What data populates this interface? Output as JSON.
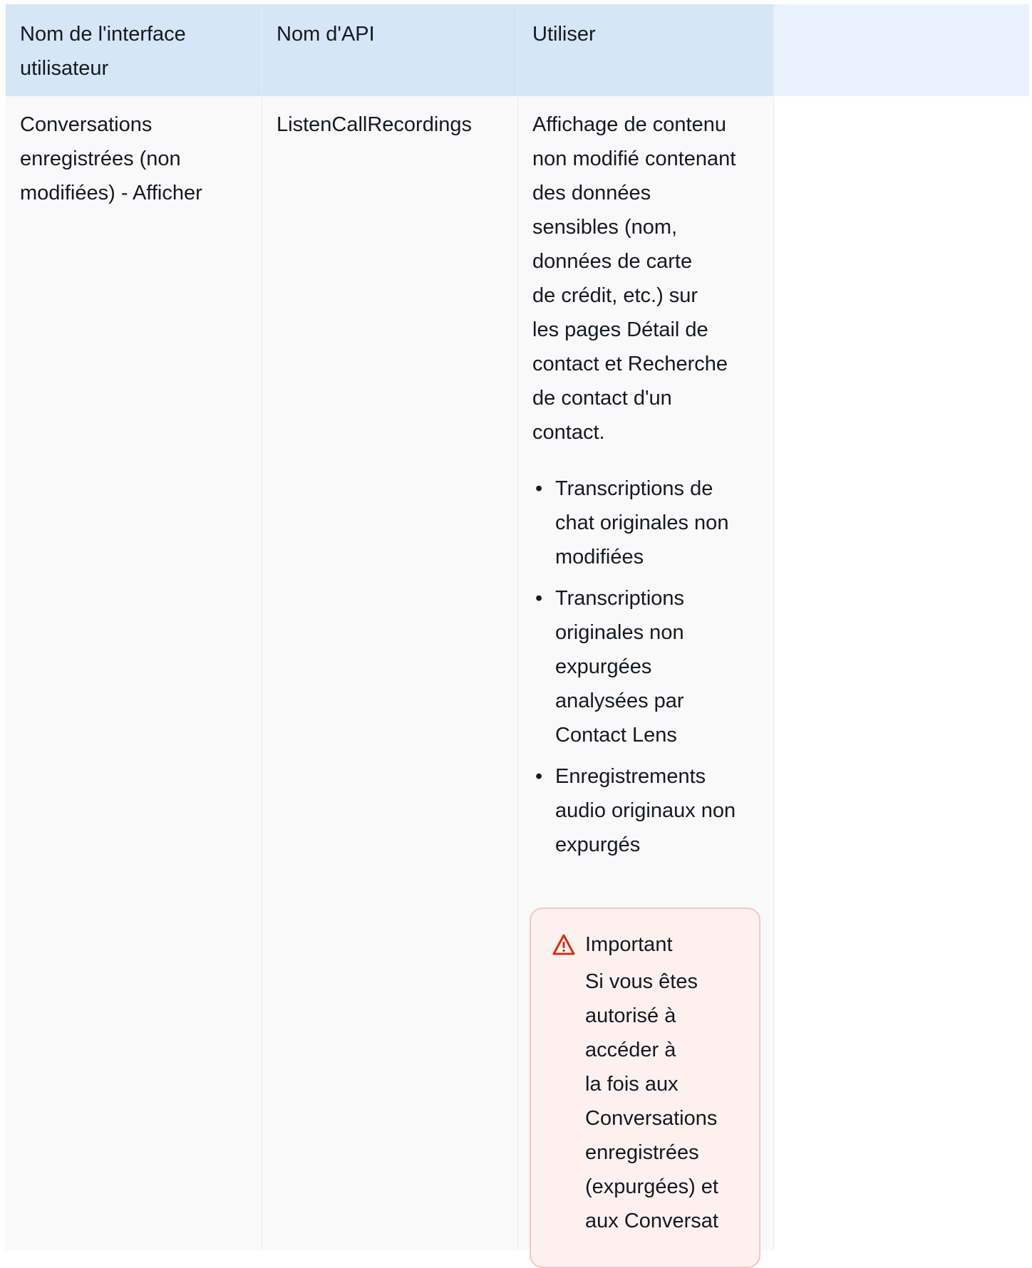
{
  "table": {
    "headers": [
      "Nom de l'interface\nutilisateur",
      "Nom d'API",
      "Utiliser",
      ""
    ],
    "rows": [
      {
        "ui_name": "Conversations\nenregistrées (non\nmodifiées) - Afficher",
        "api_name": "ListenCallRecordings",
        "usage": {
          "description": "Affichage de contenu\nnon modifié contenant\ndes données\nsensibles (nom,\ndonnées de carte\nde crédit, etc.) sur\nles pages Détail de\ncontact et Recherche\nde contact d'un\ncontact.",
          "bullets": [
            "Transcriptions de\nchat originales non\nmodifiées",
            "Transcriptions\noriginales non\nexpurgées\nanalysées par\nContact Lens",
            "Enregistrements\naudio originaux non\nexpurgés"
          ],
          "alert": {
            "icon": "warning-icon",
            "title": "Important",
            "text": "Si vous êtes\nautorisé à\naccéder à\nla fois aux\nConversations\nenregistrées\n(expurgées) et\naux Conversat"
          }
        }
      }
    ]
  },
  "colors": {
    "header_bg": "#d5e6f7",
    "body_bg": "#f9f9f9",
    "alert_bg": "#fdf1f0",
    "alert_border": "#f7c5c5",
    "alert_icon": "#d13212"
  }
}
